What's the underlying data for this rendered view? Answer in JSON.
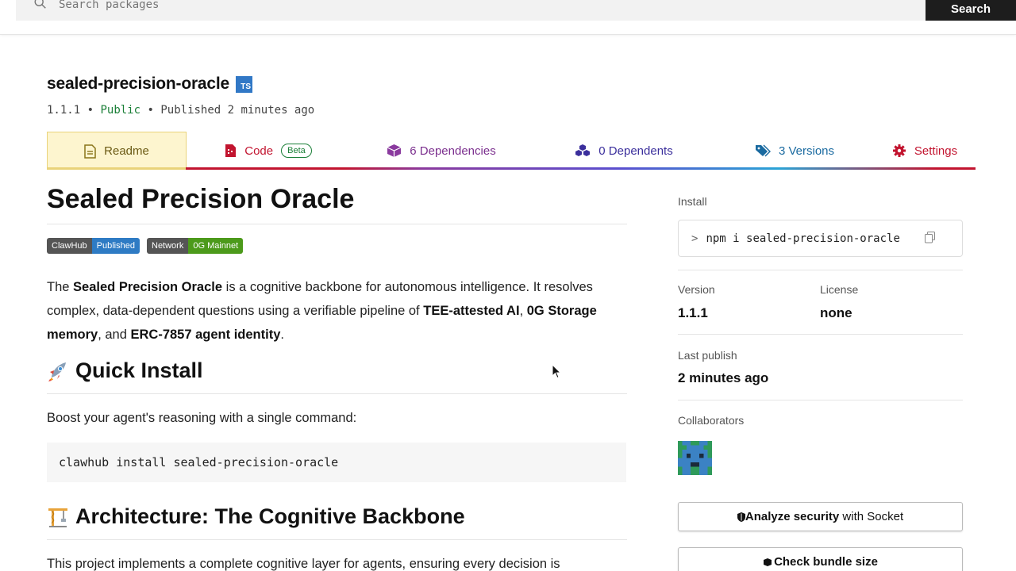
{
  "search": {
    "placeholder": "Search packages",
    "button_label": "Search"
  },
  "package": {
    "name": "sealed-precision-oracle",
    "ts_badge": "TS",
    "version": "1.1.1",
    "sep": "•",
    "visibility": "Public",
    "published": "Published 2 minutes ago"
  },
  "tabs": {
    "readme": "Readme",
    "code": "Code",
    "code_badge": "Beta",
    "dependencies": "6 Dependencies",
    "dependents": "0 Dependents",
    "versions": "3 Versions",
    "settings": "Settings"
  },
  "colors": {
    "readme_tab": "#fdf5cf",
    "code_tab": "#c2142f",
    "dependencies_tab": "#7b2f8e",
    "dependents_tab": "#3b2f9c",
    "versions_tab": "#1a6aa0",
    "settings_tab": "#c2142f"
  },
  "readme": {
    "title": "Sealed Precision Oracle",
    "shields": [
      {
        "label": "ClawHub",
        "value": "Published",
        "color": "#2e7bc4"
      },
      {
        "label": "Network",
        "value": "0G Mainnet",
        "color": "#4c9a1b"
      }
    ],
    "intro": {
      "p1": "The ",
      "b1": "Sealed Precision Oracle",
      "p2": " is a cognitive backbone for autonomous intelligence. It resolves complex, data-dependent questions using a verifiable pipeline of ",
      "b2": "TEE-attested AI",
      "p3": ", ",
      "b3": "0G Storage memory",
      "p4": ", and ",
      "b4": "ERC-7857 agent identity",
      "p5": "."
    },
    "quick_install_heading": "Quick Install",
    "quick_install_icon": "rocket-icon",
    "quick_install_text": "Boost your agent's reasoning with a single command:",
    "install_command": "clawhub install sealed-precision-oracle",
    "architecture_heading": "Architecture: The Cognitive Backbone",
    "architecture_icon": "construction-crane-icon",
    "architecture_text": "This project implements a complete cognitive layer for agents, ensuring every decision is"
  },
  "sidebar": {
    "install_label": "Install",
    "install_prompt": ">",
    "install_command": "npm i sealed-precision-oracle",
    "version_label": "Version",
    "version_value": "1.1.1",
    "license_label": "License",
    "license_value": "none",
    "last_publish_label": "Last publish",
    "last_publish_value": "2 minutes ago",
    "collaborators_label": "Collaborators",
    "analyze_bold": "Analyze security",
    "analyze_rest": " with Socket",
    "bundle_label": "Check bundle size"
  }
}
